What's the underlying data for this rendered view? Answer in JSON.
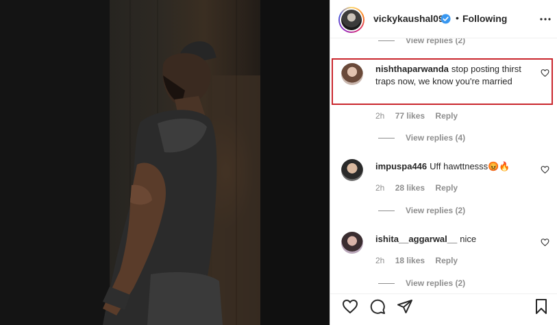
{
  "header": {
    "username": "vickykaushal09",
    "separator": "•",
    "follow_status": "Following"
  },
  "top_view_replies": "View replies (2)",
  "comments": [
    {
      "username": "nishthaparwanda",
      "text": "stop posting thirst traps now, we know you're married",
      "time": "2h",
      "likes": "77 likes",
      "reply": "Reply",
      "view_replies": "View replies (4)"
    },
    {
      "username": "impuspa446",
      "text": "Uff hawttnesss",
      "emoji": "😡🔥",
      "time": "2h",
      "likes": "28 likes",
      "reply": "Reply",
      "view_replies": "View replies (2)"
    },
    {
      "username": "ishita__aggarwal__",
      "text": "nice",
      "time": "2h",
      "likes": "18 likes",
      "reply": "Reply",
      "view_replies": "View replies (2)"
    }
  ],
  "icons": {
    "verified": "verified-badge-icon",
    "more": "more-options-icon",
    "heart": "heart-icon",
    "like": "like-icon",
    "comment": "comment-icon",
    "share": "share-icon",
    "save": "bookmark-icon"
  },
  "colors": {
    "highlight_border": "#c9252c",
    "verified_blue": "#3897f0",
    "muted_text": "#8e8e8e"
  }
}
